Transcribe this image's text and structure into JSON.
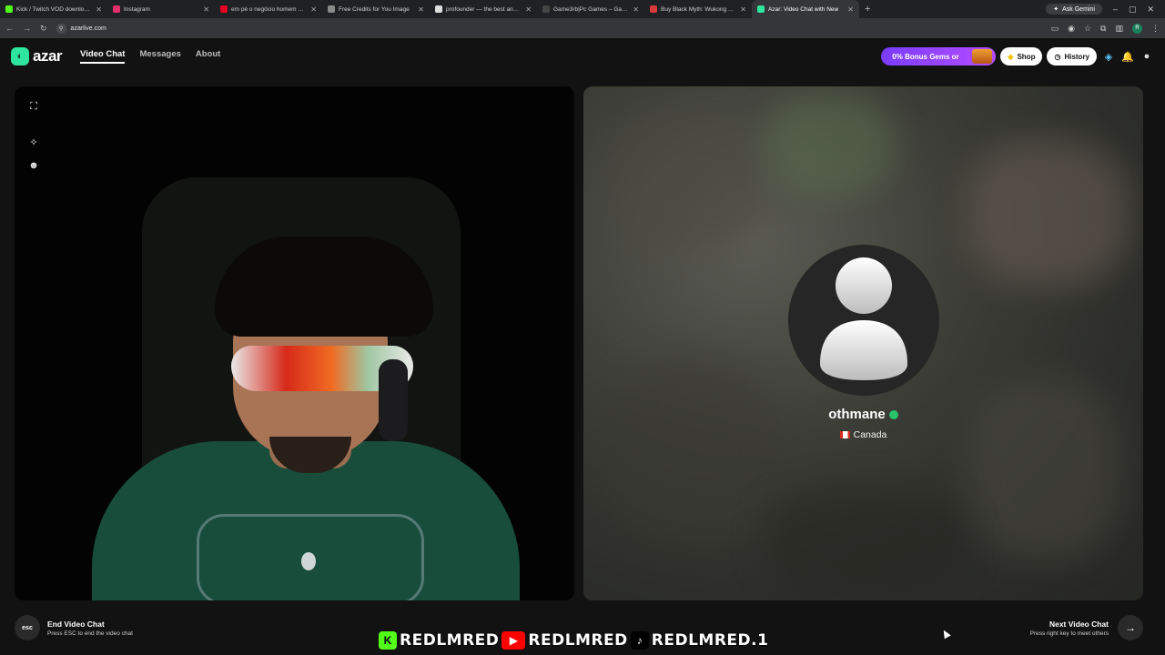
{
  "browser": {
    "tabs": [
      {
        "title": "Kick / Twitch VOD downloader",
        "color": "#53fc18"
      },
      {
        "title": "Instagram",
        "color": "#e1306c"
      },
      {
        "title": "em pé o negócio homem apoia",
        "color": "#e60023"
      },
      {
        "title": "Free Credits for You  Image",
        "color": "#8a8a8a"
      },
      {
        "title": "profounder — the best and fre",
        "color": "#dddddd"
      },
      {
        "title": "Game3rb|Pc Games – Games Gr",
        "color": "#444444"
      },
      {
        "title": "Buy Black Myth: Wukong Accou",
        "color": "#d63a3a"
      },
      {
        "title": "Azar: Video Chat with New",
        "color": "#2ee59d"
      }
    ],
    "ask_gemini": "Ask Gemini",
    "url": "azarlive.com",
    "profile_initial": "R"
  },
  "app": {
    "logo_text": "azar",
    "nav": [
      {
        "label": "Video Chat"
      },
      {
        "label": "Messages"
      },
      {
        "label": "About"
      }
    ],
    "bonus_label": "0% Bonus Gems or",
    "shop_label": "Shop",
    "history_label": "History"
  },
  "partner": {
    "name": "othmane",
    "country": "Canada"
  },
  "controls": {
    "end_title": "End Video Chat",
    "end_sub": "Press ESC to end the video chat",
    "esc_label": "esc",
    "next_title": "Next Video Chat",
    "next_sub": "Press right key to meet others"
  },
  "watermark": {
    "items": [
      "REDLMRED",
      "REDLMRED",
      "REDLMRED.1"
    ]
  },
  "colors": {
    "accent": "#2ee59d",
    "bonus": "#8a3cff",
    "background": "#121212"
  }
}
